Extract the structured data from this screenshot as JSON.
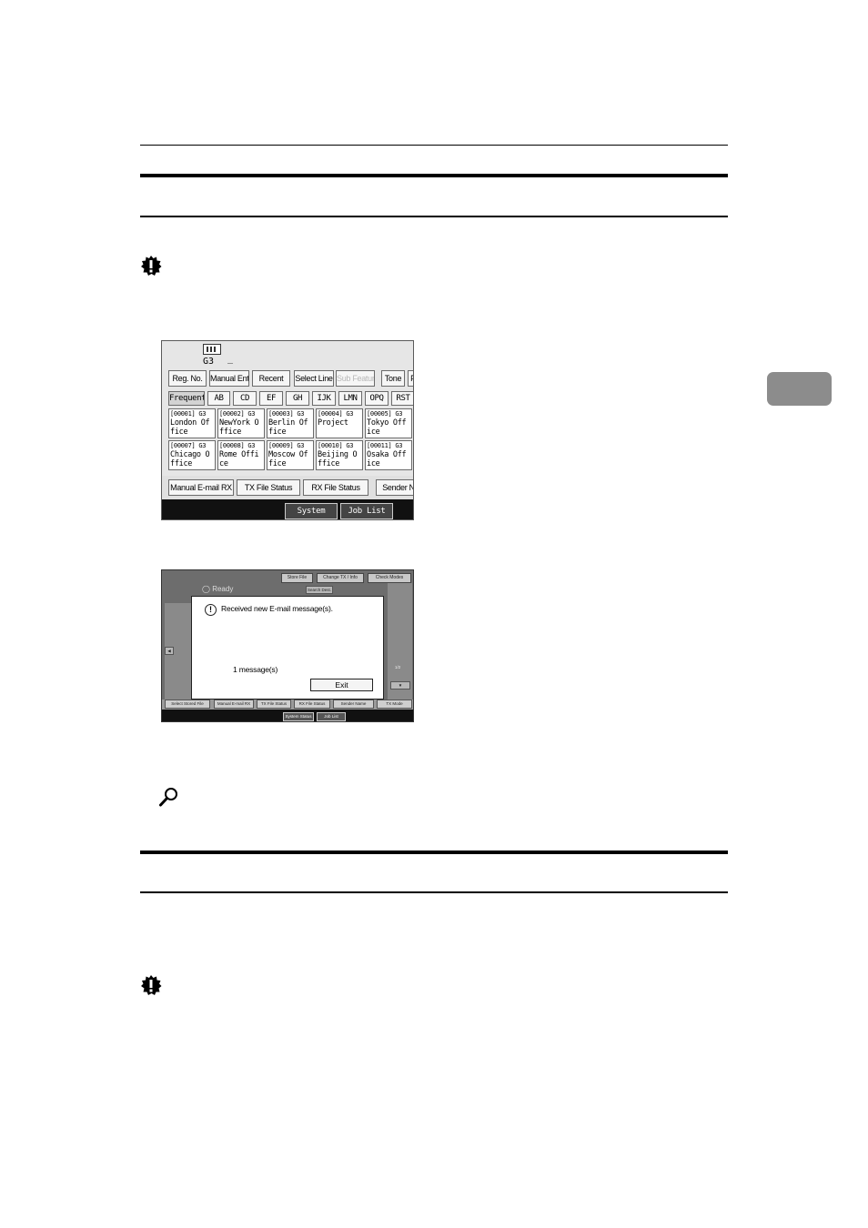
{
  "screen1": {
    "line_mode": "G3",
    "cursor": "_",
    "top_buttons": [
      "Reg. No.",
      "Manual Entry",
      "Recent",
      "Select Line",
      "Sub Features",
      "Tone",
      "P"
    ],
    "tabs": [
      "Frequent",
      "AB",
      "CD",
      "EF",
      "GH",
      "IJK",
      "LMN",
      "OPQ",
      "RST"
    ],
    "destinations": [
      {
        "code": "[00001]",
        "line": "G3",
        "name": "London Office"
      },
      {
        "code": "[00002]",
        "line": "G3",
        "name": "NewYork Office"
      },
      {
        "code": "[00003]",
        "line": "G3",
        "name": "Berlin Office"
      },
      {
        "code": "[00004]",
        "line": "G3",
        "name": "Project"
      },
      {
        "code": "[00005]",
        "line": "G3",
        "name": "Tokyo Office"
      },
      {
        "code": "[00007]",
        "line": "G3",
        "name": "Chicago Office"
      },
      {
        "code": "[00008]",
        "line": "G3",
        "name": "Rome Office"
      },
      {
        "code": "[00009]",
        "line": "G3",
        "name": "Moscow Office"
      },
      {
        "code": "[00010]",
        "line": "G3",
        "name": "Beijing Office"
      },
      {
        "code": "[00011]",
        "line": "G3",
        "name": "Osaka Office"
      }
    ],
    "bottom_buttons": [
      "Manual E-mail RX",
      "TX File Status",
      "RX File Status",
      "Sender N"
    ],
    "system_buttons": [
      "System Status",
      "Job List"
    ]
  },
  "screen2": {
    "top_buttons": [
      "Store File",
      "Change TX / Info",
      "Check Modes"
    ],
    "ready": "Ready",
    "search_dest": "Search Dest.",
    "dialog_message": "Received new E-mail message(s).",
    "message_count": "1 message(s)",
    "exit_label": "Exit",
    "bottom_buttons": [
      "Select Stored File",
      "Manual E-mail RX",
      "TX File Status",
      "RX File Status",
      "Sender Name",
      "TX Mode"
    ],
    "system_buttons": [
      "System Status",
      "Job List"
    ],
    "page_indicator": "1/2"
  }
}
